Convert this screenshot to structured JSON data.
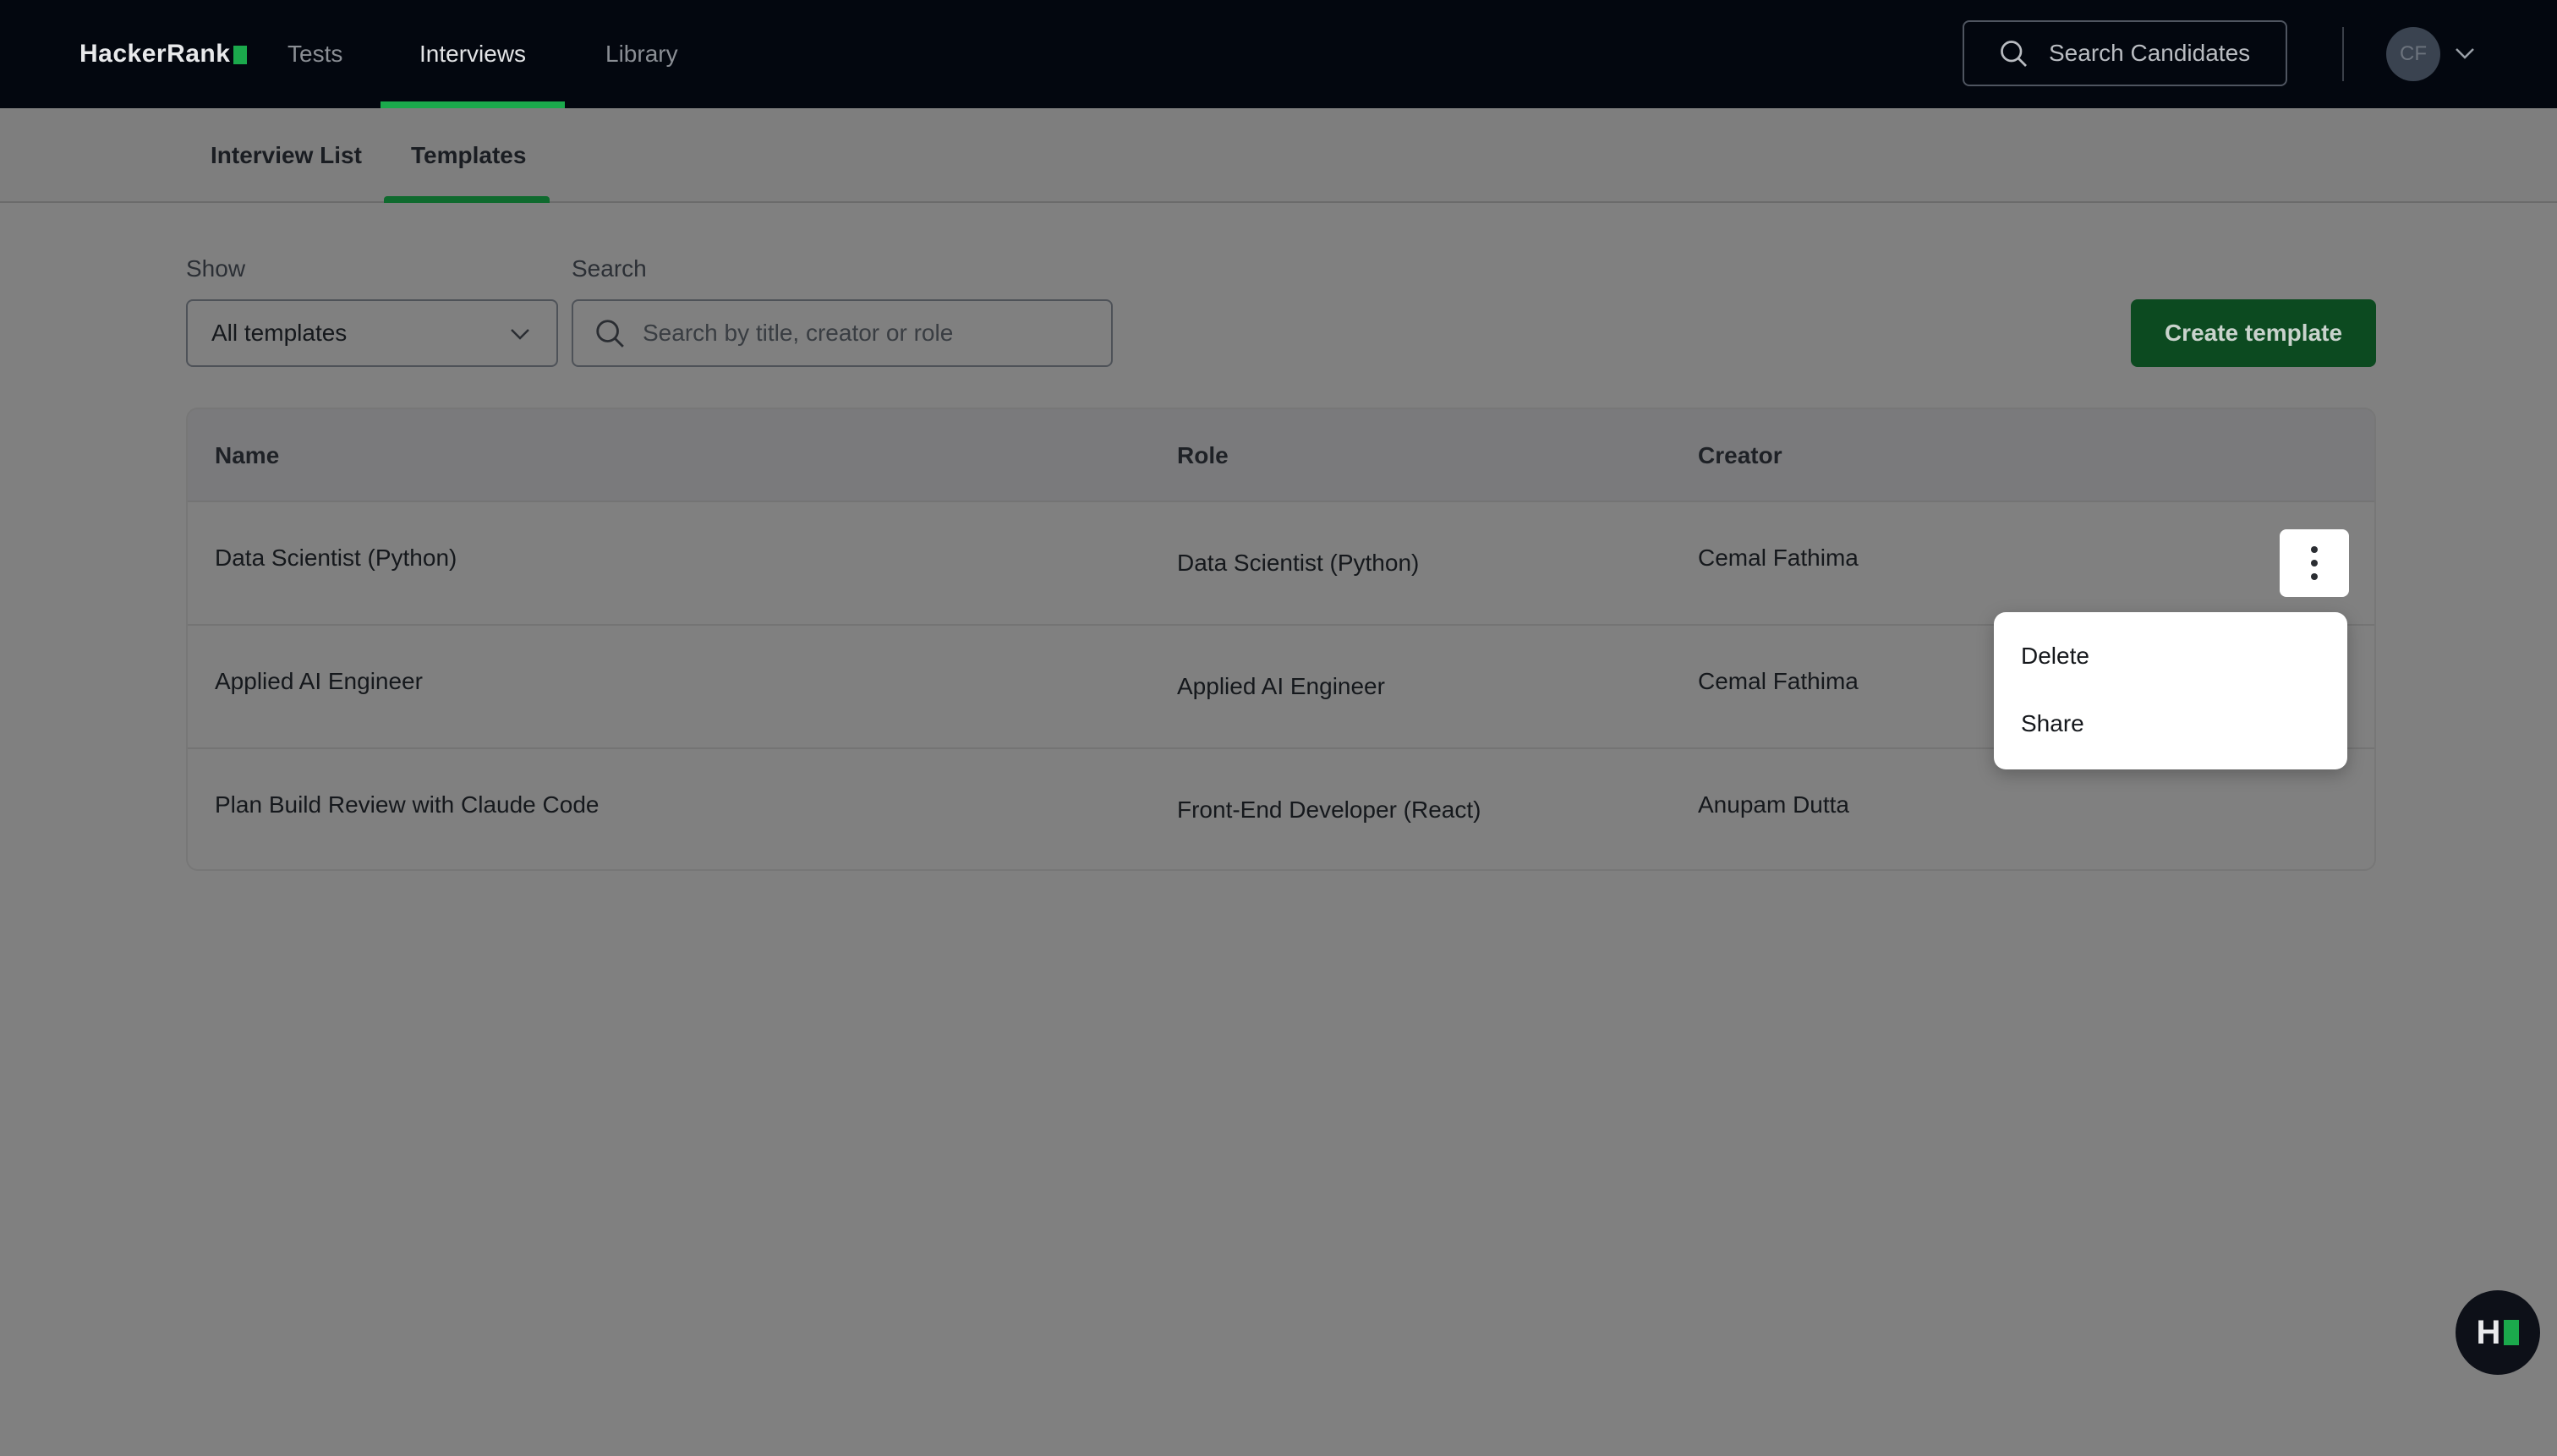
{
  "brand": {
    "logo_text": "HackerRank"
  },
  "topnav": {
    "links": [
      {
        "label": "Tests"
      },
      {
        "label": "Interviews"
      },
      {
        "label": "Library"
      }
    ],
    "active_link": "Interviews",
    "search_candidates_label": "Search Candidates",
    "avatar_initials": "CF"
  },
  "subtabs": {
    "items": [
      {
        "label": "Interview List"
      },
      {
        "label": "Templates"
      }
    ],
    "active": "Templates"
  },
  "filters": {
    "show_label": "Show",
    "show_value": "All templates",
    "search_label": "Search",
    "search_placeholder": "Search by title, creator or role",
    "search_value": ""
  },
  "actions": {
    "create_label": "Create template"
  },
  "table": {
    "headers": {
      "name": "Name",
      "role": "Role",
      "creator": "Creator"
    },
    "rows": [
      {
        "name": "Data Scientist (Python)",
        "role": "Data Scientist (Python)",
        "creator": "Cemal Fathima"
      },
      {
        "name": "Applied AI Engineer",
        "role": "Applied AI Engineer",
        "creator": "Cemal Fathima"
      },
      {
        "name": "Plan Build Review with Claude Code",
        "role": "Front-End Developer (React)",
        "creator": "Anupam Dutta"
      }
    ]
  },
  "context_menu": {
    "items": [
      {
        "label": "Delete"
      },
      {
        "label": "Share"
      }
    ]
  },
  "help_button": {
    "text": "H"
  },
  "colors": {
    "nav_bg": "#03070f",
    "accent_green": "#1ba94c",
    "primary_button": "#0c4a20",
    "overlay_bg": "#808080"
  }
}
